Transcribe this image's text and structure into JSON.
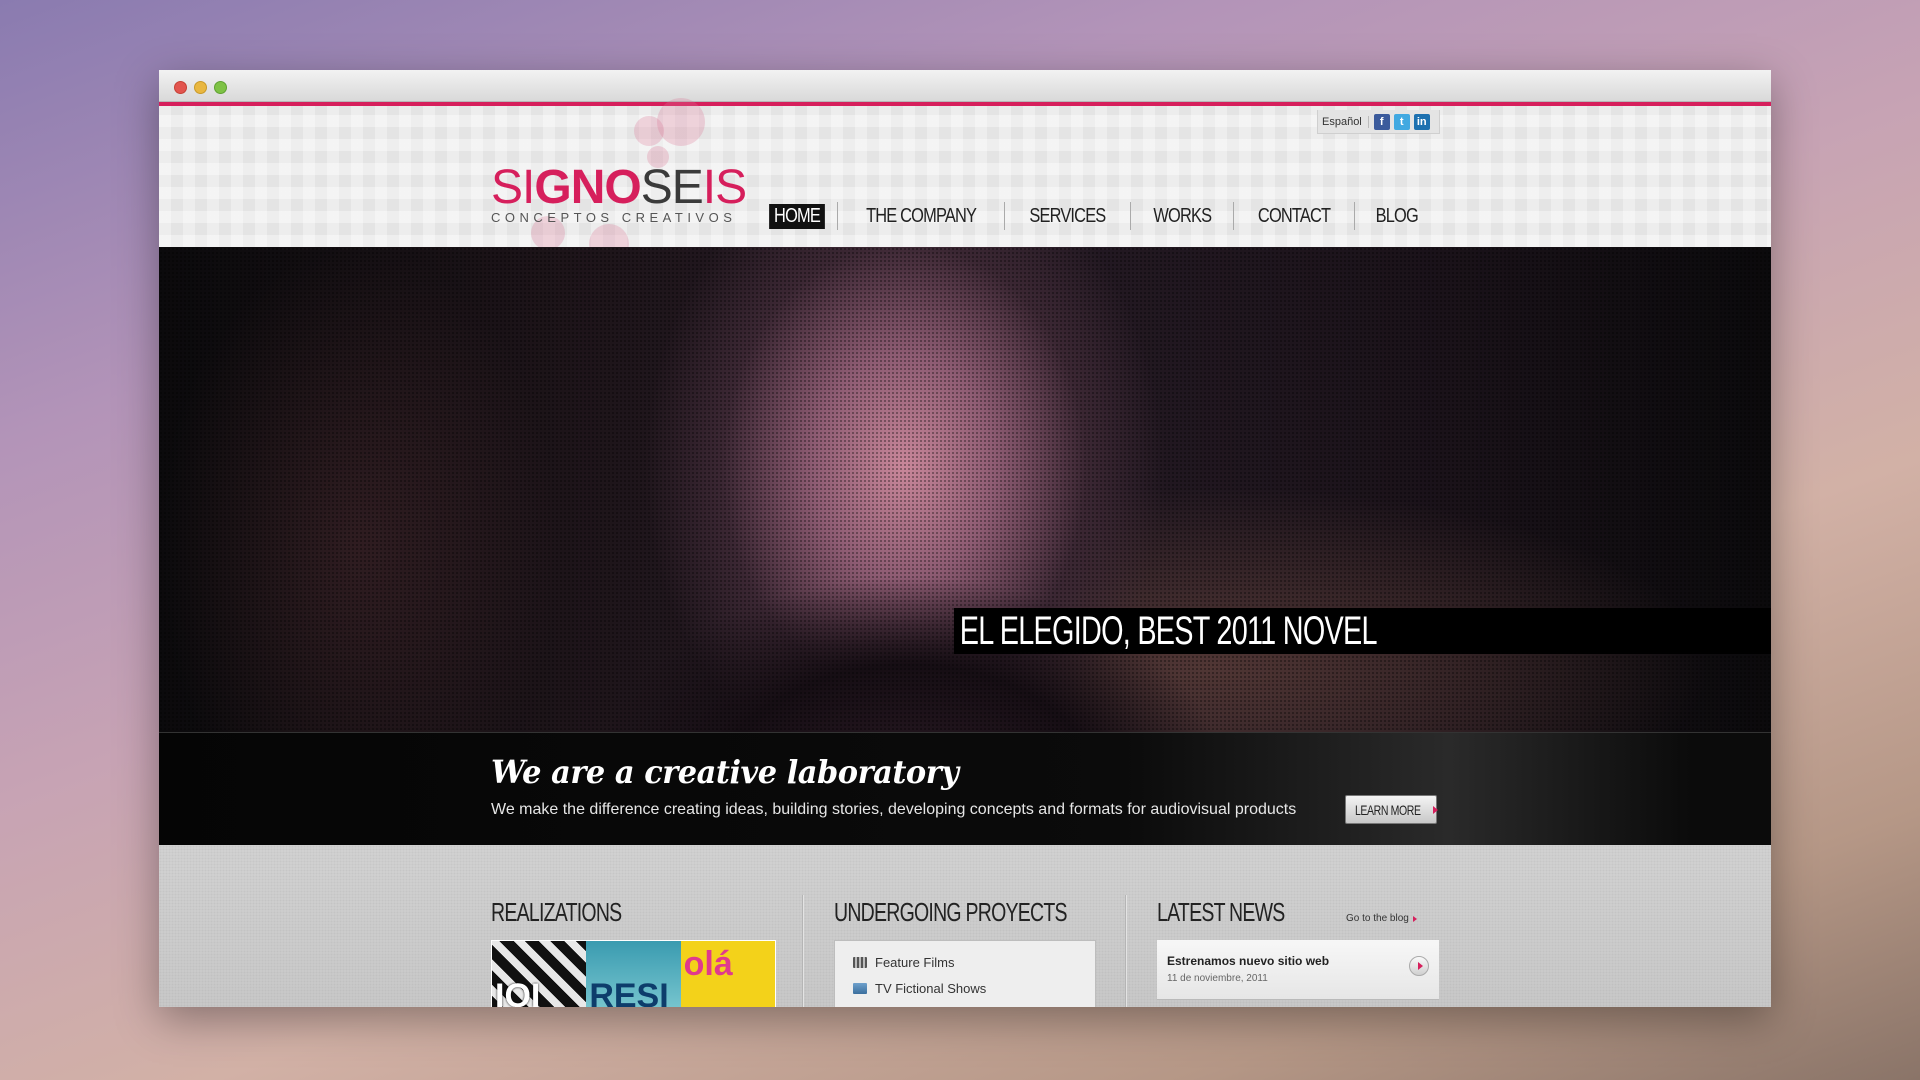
{
  "header": {
    "logo": {
      "part1": "SI",
      "part2": "GNO",
      "part3": "SE",
      "part4": "IS",
      "subtitle": "CONCEPTOS CREATIVOS"
    },
    "language": "Español",
    "social": [
      {
        "name": "facebook",
        "glyph": "f"
      },
      {
        "name": "twitter",
        "glyph": "t"
      },
      {
        "name": "linkedin",
        "glyph": "in"
      }
    ],
    "nav": [
      "HOME",
      "THE COMPANY",
      "SERVICES",
      "WORKS",
      "CONTACT",
      "BLOG"
    ],
    "active_nav": "HOME"
  },
  "hero": {
    "caption": "EL ELEGIDO, BEST 2011 NOVEL"
  },
  "tagline": {
    "title": "We are a creative laboratory",
    "text": "We make the difference creating ideas, building stories, developing concepts and formats for audiovisual products",
    "button": "LEARN MORE"
  },
  "sections": {
    "realizations": {
      "title": "REALIZATIONS",
      "thumb_words": [
        "IOI",
        "RESI",
        "olá"
      ]
    },
    "projects": {
      "title": "UNDERGOING PROYECTS",
      "items": [
        "Feature Films",
        "TV Fictional Shows"
      ]
    },
    "news": {
      "title": "LATEST NEWS",
      "blog_link": "Go to the blog",
      "item_title": "Estrenamos nuevo sitio web",
      "item_date": "11 de noviembre, 2011"
    }
  },
  "colors": {
    "accent": "#d61f5c",
    "dark": "#111111"
  }
}
